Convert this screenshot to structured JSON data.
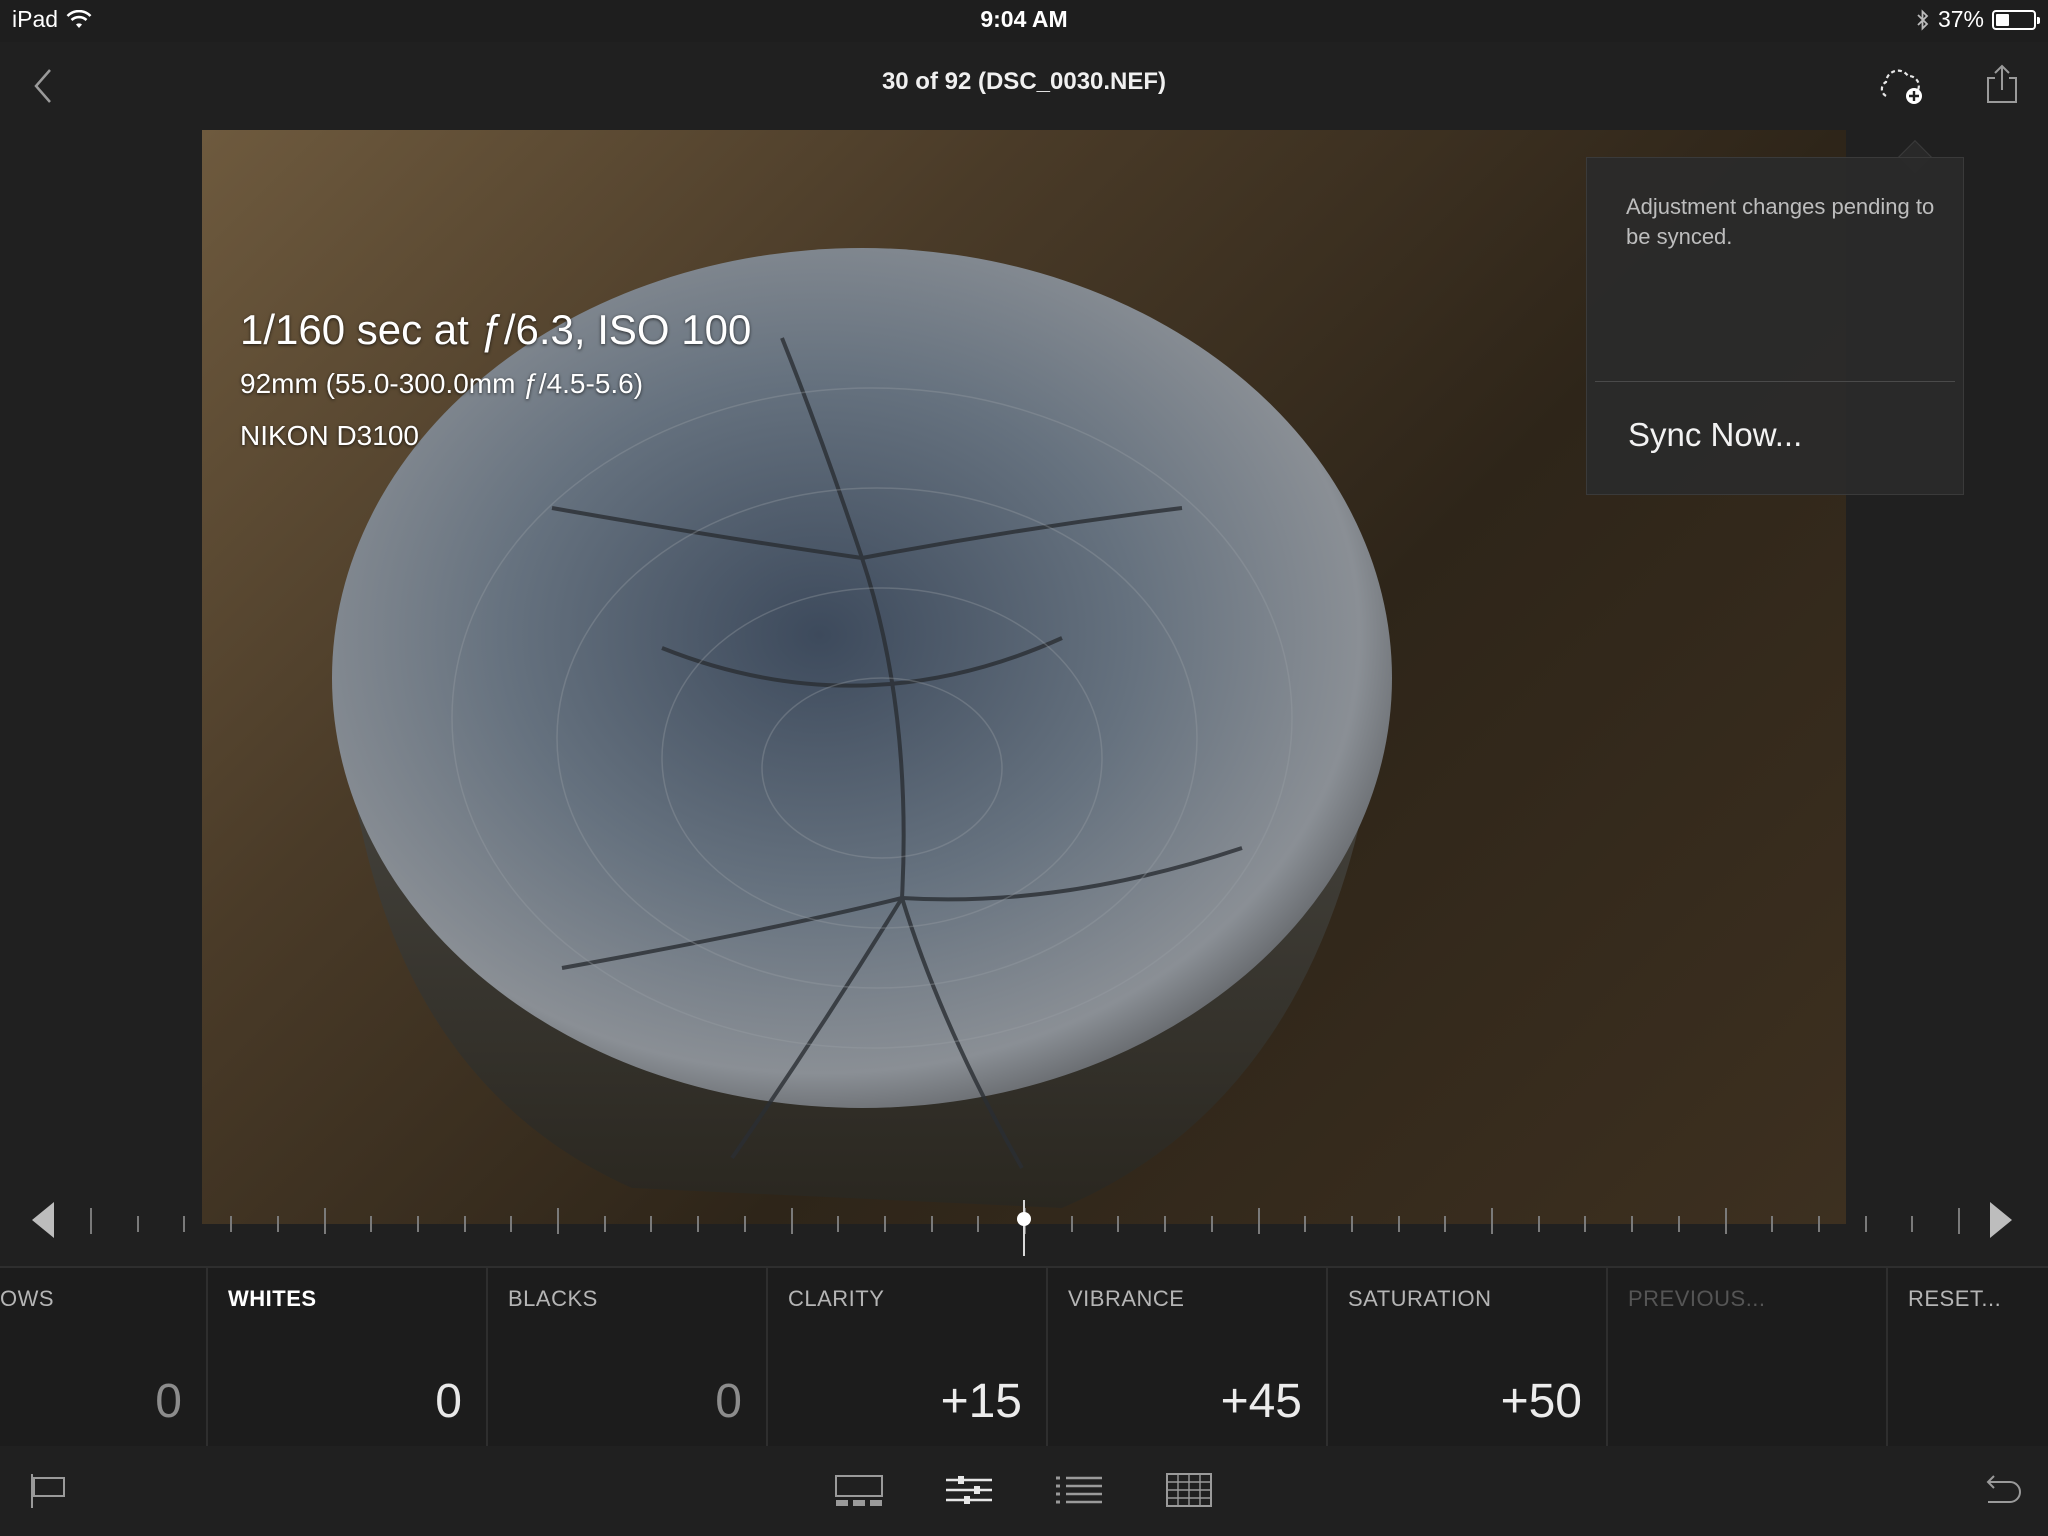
{
  "status_bar": {
    "device": "iPad",
    "time": "9:04 AM",
    "battery_percent": "37%",
    "battery_level": 0.37
  },
  "toolbar": {
    "title": "30 of 92 (DSC_0030.NEF)"
  },
  "photo": {
    "exif_line1": "1/160 sec at ƒ/6.3, ISO 100",
    "exif_line2": "92mm (55.0-300.0mm ƒ/4.5-5.6)",
    "exif_line3": "NIKON D3100"
  },
  "popover": {
    "message": "Adjustment changes pending to be synced.",
    "action": "Sync Now..."
  },
  "adjustments": [
    {
      "label": "OWS",
      "value": "0"
    },
    {
      "label": "WHITES",
      "value": "0"
    },
    {
      "label": "BLACKS",
      "value": "0"
    },
    {
      "label": "CLARITY",
      "value": "+15"
    },
    {
      "label": "VIBRANCE",
      "value": "+45"
    },
    {
      "label": "SATURATION",
      "value": "+50"
    },
    {
      "label": "PREVIOUS...",
      "value": ""
    },
    {
      "label": "RESET...",
      "value": ""
    }
  ],
  "colors": {
    "background": "#202020",
    "panel": "#1c1c1c",
    "text_primary": "#ffffff",
    "text_secondary": "#b5b5b5",
    "disabled": "#555555"
  },
  "icons": {
    "back": "chevron-left-icon",
    "cloud_sync": "cloud-sync-icon",
    "share": "share-icon",
    "flag": "flag-icon",
    "crop_view": "crop-view-icon",
    "adjust": "sliders-icon",
    "presets": "list-icon",
    "grid": "grid-icon",
    "undo": "undo-icon"
  }
}
